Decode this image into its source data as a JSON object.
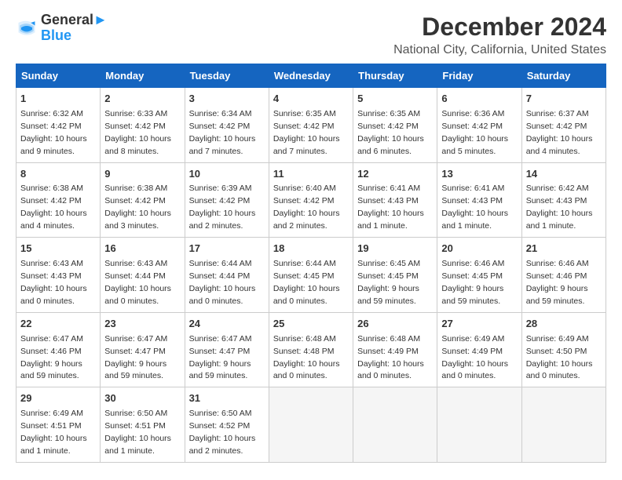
{
  "header": {
    "logo_line1": "General",
    "logo_line2": "Blue",
    "month_title": "December 2024",
    "location": "National City, California, United States"
  },
  "days_of_week": [
    "Sunday",
    "Monday",
    "Tuesday",
    "Wednesday",
    "Thursday",
    "Friday",
    "Saturday"
  ],
  "weeks": [
    [
      {
        "day": "1",
        "sunrise": "6:32 AM",
        "sunset": "4:42 PM",
        "daylight": "10 hours and 9 minutes."
      },
      {
        "day": "2",
        "sunrise": "6:33 AM",
        "sunset": "4:42 PM",
        "daylight": "10 hours and 8 minutes."
      },
      {
        "day": "3",
        "sunrise": "6:34 AM",
        "sunset": "4:42 PM",
        "daylight": "10 hours and 7 minutes."
      },
      {
        "day": "4",
        "sunrise": "6:35 AM",
        "sunset": "4:42 PM",
        "daylight": "10 hours and 7 minutes."
      },
      {
        "day": "5",
        "sunrise": "6:35 AM",
        "sunset": "4:42 PM",
        "daylight": "10 hours and 6 minutes."
      },
      {
        "day": "6",
        "sunrise": "6:36 AM",
        "sunset": "4:42 PM",
        "daylight": "10 hours and 5 minutes."
      },
      {
        "day": "7",
        "sunrise": "6:37 AM",
        "sunset": "4:42 PM",
        "daylight": "10 hours and 4 minutes."
      }
    ],
    [
      {
        "day": "8",
        "sunrise": "6:38 AM",
        "sunset": "4:42 PM",
        "daylight": "10 hours and 4 minutes."
      },
      {
        "day": "9",
        "sunrise": "6:38 AM",
        "sunset": "4:42 PM",
        "daylight": "10 hours and 3 minutes."
      },
      {
        "day": "10",
        "sunrise": "6:39 AM",
        "sunset": "4:42 PM",
        "daylight": "10 hours and 2 minutes."
      },
      {
        "day": "11",
        "sunrise": "6:40 AM",
        "sunset": "4:42 PM",
        "daylight": "10 hours and 2 minutes."
      },
      {
        "day": "12",
        "sunrise": "6:41 AM",
        "sunset": "4:43 PM",
        "daylight": "10 hours and 1 minute."
      },
      {
        "day": "13",
        "sunrise": "6:41 AM",
        "sunset": "4:43 PM",
        "daylight": "10 hours and 1 minute."
      },
      {
        "day": "14",
        "sunrise": "6:42 AM",
        "sunset": "4:43 PM",
        "daylight": "10 hours and 1 minute."
      }
    ],
    [
      {
        "day": "15",
        "sunrise": "6:43 AM",
        "sunset": "4:43 PM",
        "daylight": "10 hours and 0 minutes."
      },
      {
        "day": "16",
        "sunrise": "6:43 AM",
        "sunset": "4:44 PM",
        "daylight": "10 hours and 0 minutes."
      },
      {
        "day": "17",
        "sunrise": "6:44 AM",
        "sunset": "4:44 PM",
        "daylight": "10 hours and 0 minutes."
      },
      {
        "day": "18",
        "sunrise": "6:44 AM",
        "sunset": "4:45 PM",
        "daylight": "10 hours and 0 minutes."
      },
      {
        "day": "19",
        "sunrise": "6:45 AM",
        "sunset": "4:45 PM",
        "daylight": "9 hours and 59 minutes."
      },
      {
        "day": "20",
        "sunrise": "6:46 AM",
        "sunset": "4:45 PM",
        "daylight": "9 hours and 59 minutes."
      },
      {
        "day": "21",
        "sunrise": "6:46 AM",
        "sunset": "4:46 PM",
        "daylight": "9 hours and 59 minutes."
      }
    ],
    [
      {
        "day": "22",
        "sunrise": "6:47 AM",
        "sunset": "4:46 PM",
        "daylight": "9 hours and 59 minutes."
      },
      {
        "day": "23",
        "sunrise": "6:47 AM",
        "sunset": "4:47 PM",
        "daylight": "9 hours and 59 minutes."
      },
      {
        "day": "24",
        "sunrise": "6:47 AM",
        "sunset": "4:47 PM",
        "daylight": "9 hours and 59 minutes."
      },
      {
        "day": "25",
        "sunrise": "6:48 AM",
        "sunset": "4:48 PM",
        "daylight": "10 hours and 0 minutes."
      },
      {
        "day": "26",
        "sunrise": "6:48 AM",
        "sunset": "4:49 PM",
        "daylight": "10 hours and 0 minutes."
      },
      {
        "day": "27",
        "sunrise": "6:49 AM",
        "sunset": "4:49 PM",
        "daylight": "10 hours and 0 minutes."
      },
      {
        "day": "28",
        "sunrise": "6:49 AM",
        "sunset": "4:50 PM",
        "daylight": "10 hours and 0 minutes."
      }
    ],
    [
      {
        "day": "29",
        "sunrise": "6:49 AM",
        "sunset": "4:51 PM",
        "daylight": "10 hours and 1 minute."
      },
      {
        "day": "30",
        "sunrise": "6:50 AM",
        "sunset": "4:51 PM",
        "daylight": "10 hours and 1 minute."
      },
      {
        "day": "31",
        "sunrise": "6:50 AM",
        "sunset": "4:52 PM",
        "daylight": "10 hours and 2 minutes."
      },
      null,
      null,
      null,
      null
    ]
  ]
}
